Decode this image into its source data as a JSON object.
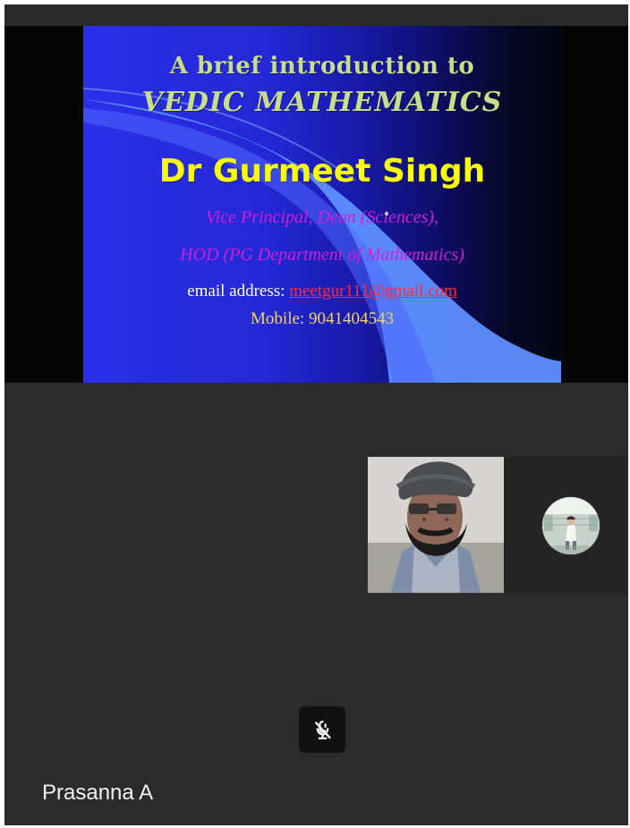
{
  "presentation": {
    "title_line_1": "A brief introduction to",
    "title_line_2": "VEDIC MATHEMATICS",
    "presenter_name": "Dr Gurmeet Singh",
    "role_line_1": "Vice Principal, Dean (Sciences),",
    "role_line_2": "HOD (PG Department of Mathematics)",
    "email_label": "email address:",
    "email_value": "meetgur111@gmail.com",
    "mobile_text": "Mobile: 9041404543"
  },
  "participants": {
    "active_speaker_name": "Prasanna A"
  },
  "controls": {
    "mic_state": "muted",
    "mic_icon": "microphone-off-icon"
  },
  "colors": {
    "app_background": "#2b2b2b",
    "slide_blue": "#2b2fe8",
    "slide_title": "#c7dd8a",
    "presenter_name": "#f7ff00",
    "role_text": "#d21fd4",
    "email_link": "#ff2a3b"
  }
}
